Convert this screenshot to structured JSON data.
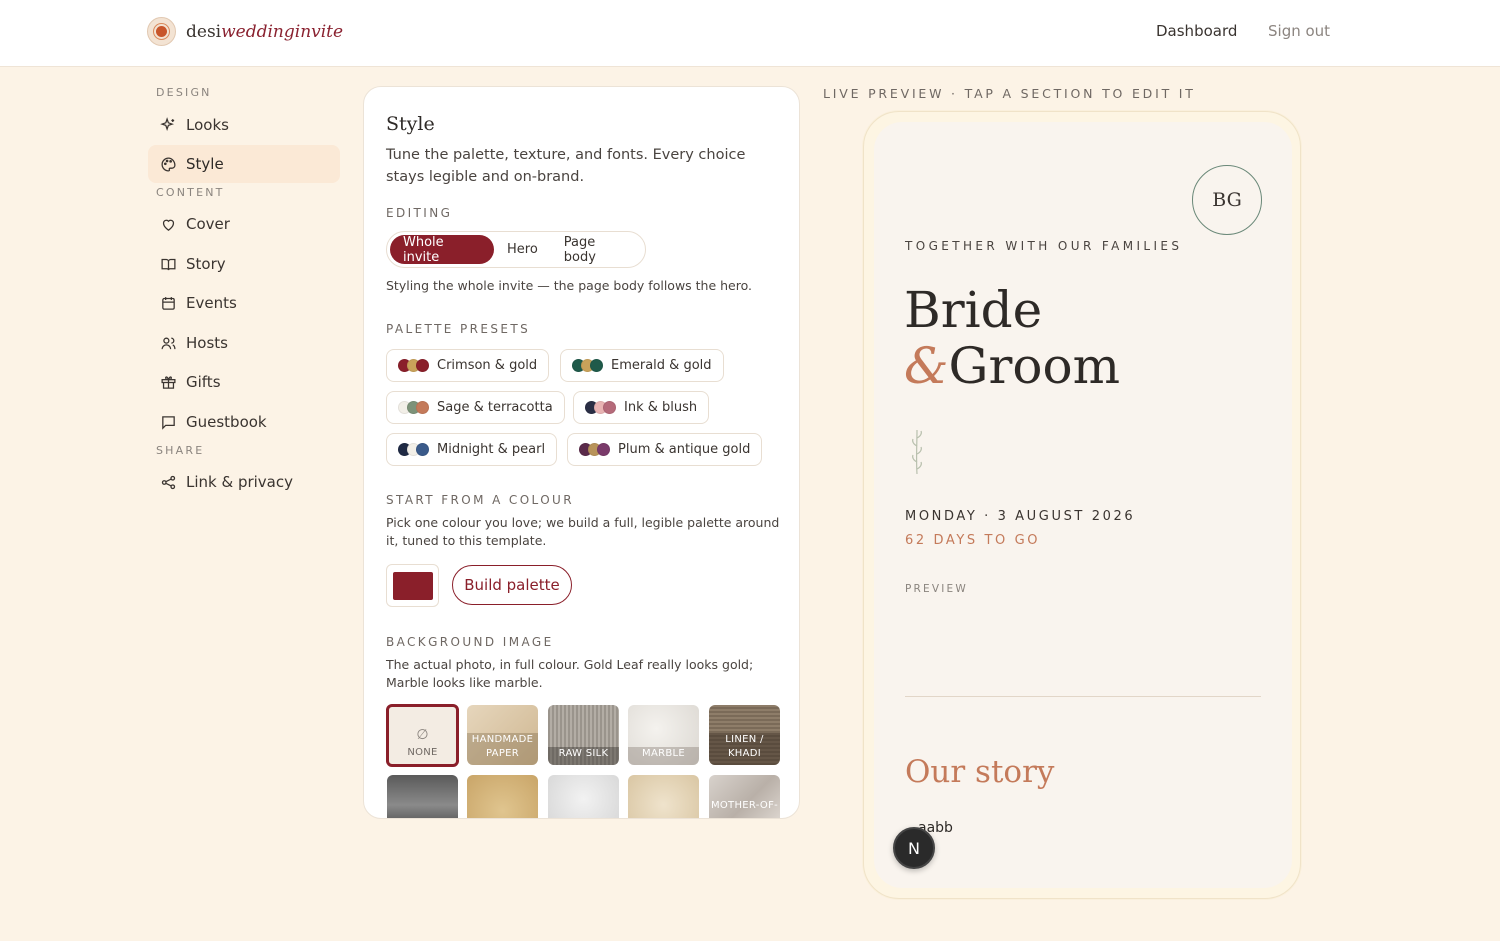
{
  "brand": {
    "prefix": "desi",
    "suffix": "weddinginvite"
  },
  "nav": {
    "dashboard": "Dashboard",
    "signout": "Sign out"
  },
  "sidebar": {
    "sections": {
      "design": "DESIGN",
      "content": "CONTENT",
      "share": "SHARE"
    },
    "items": [
      {
        "label": "Looks",
        "icon": "sparkle-icon"
      },
      {
        "label": "Style",
        "icon": "palette-icon"
      },
      {
        "label": "Cover",
        "icon": "heart-icon"
      },
      {
        "label": "Story",
        "icon": "book-icon"
      },
      {
        "label": "Events",
        "icon": "calendar-icon"
      },
      {
        "label": "Hosts",
        "icon": "users-icon"
      },
      {
        "label": "Gifts",
        "icon": "gift-icon"
      },
      {
        "label": "Guestbook",
        "icon": "message-icon"
      },
      {
        "label": "Link & privacy",
        "icon": "share-icon"
      }
    ]
  },
  "panel": {
    "title": "Style",
    "description": "Tune the palette, texture, and fonts. Every choice stays legible and on-brand.",
    "editing_label": "EDITING",
    "editing_tabs": [
      "Whole invite",
      "Hero",
      "Page body"
    ],
    "editing_note": "Styling the whole invite — the page body follows the hero.",
    "palette_label": "PALETTE PRESETS",
    "palettes": [
      {
        "label": "Crimson & gold",
        "colors": [
          "#8a1f2a",
          "#c9a25a",
          "#8a1f2a"
        ]
      },
      {
        "label": "Emerald & gold",
        "colors": [
          "#1f5a4a",
          "#c9a25a",
          "#1f5a4a"
        ]
      },
      {
        "label": "Sage & terracotta",
        "colors": [
          "#f2efe8",
          "#7d9279",
          "#c47a5a"
        ]
      },
      {
        "label": "Ink & blush",
        "colors": [
          "#2a2e45",
          "#e8b3b3",
          "#b56a7a"
        ]
      },
      {
        "label": "Midnight & pearl",
        "colors": [
          "#1f2a44",
          "#f2efe8",
          "#3a5a8a"
        ]
      },
      {
        "label": "Plum & antique gold",
        "colors": [
          "#5a2a4a",
          "#b8935a",
          "#7a3a6a"
        ]
      }
    ],
    "colour_label": "START FROM A COLOUR",
    "colour_desc": "Pick one colour you love; we build a full, legible palette around it, tuned to this template.",
    "colour_value": "#8a1f2a",
    "build_button": "Build palette",
    "bg_label": "BACKGROUND IMAGE",
    "bg_desc": "The actual photo, in full colour. Gold Leaf really looks gold; Marble looks like marble.",
    "none_icon": "∅",
    "backgrounds": [
      {
        "label": "NONE"
      },
      {
        "label": "HANDMADE PAPER"
      },
      {
        "label": "RAW SILK"
      },
      {
        "label": "MARBLE"
      },
      {
        "label": "LINEN / KHADI"
      },
      {
        "label": ""
      },
      {
        "label": ""
      },
      {
        "label": ""
      },
      {
        "label": ""
      },
      {
        "label": "MOTHER-OF-"
      }
    ]
  },
  "preview": {
    "label": "LIVE PREVIEW · TAP A SECTION TO EDIT IT",
    "monogram": "BG",
    "together": "TOGETHER WITH OUR FAMILIES",
    "bride": "Bride",
    "amp": "&",
    "groom": "Groom",
    "date": "MONDAY · 3 AUGUST 2026",
    "countdown": "62 DAYS TO GO",
    "tag": "PREVIEW",
    "story_title": "Our story",
    "story_text": "aabb"
  },
  "badge": "N"
}
